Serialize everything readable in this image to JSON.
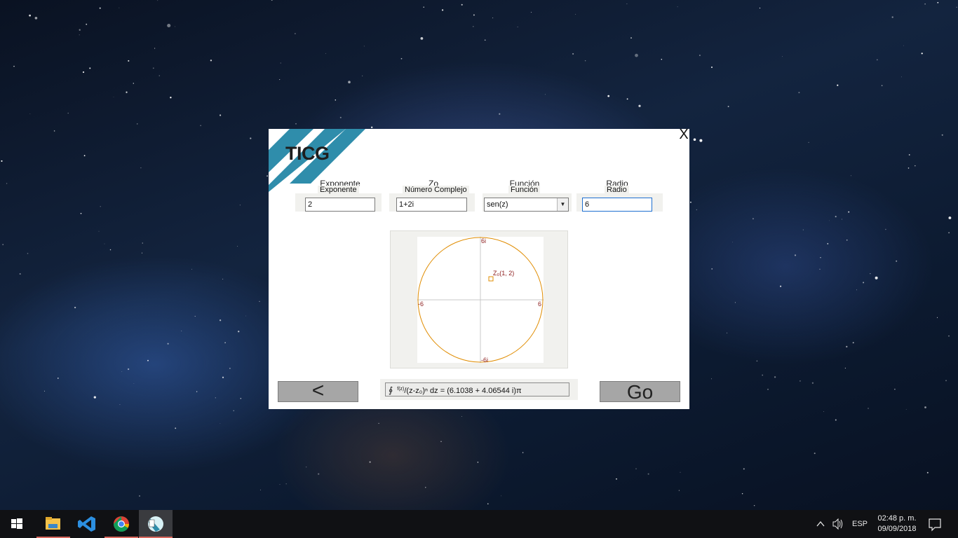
{
  "window": {
    "logo": "TICG",
    "close_label": "X",
    "colors": {
      "stripe": "#2f8dab",
      "background": "#ffffff",
      "panel": "#f1f1ee",
      "circle": "#e08c00",
      "axis_text": "#8b1a1a"
    }
  },
  "fields": {
    "exponente": {
      "title": "Exponente",
      "label": "Exponente",
      "value": "2"
    },
    "zo": {
      "title": "Zo",
      "label": "Número Complejo",
      "value": "1+2i"
    },
    "funcion": {
      "title": "Función",
      "label": "Función",
      "value": "sen(z)"
    },
    "radio": {
      "title": "Radio",
      "label": "Radio",
      "value": "6"
    }
  },
  "graph": {
    "top_label": "6i",
    "bottom_label": "-6i",
    "left_label": "-6",
    "right_label": "6",
    "point_label": "Z₀(1, 2)",
    "radius": 6,
    "center": {
      "re": 1,
      "im": 2
    }
  },
  "buttons": {
    "back_label": "<",
    "go_label": "Go"
  },
  "result": {
    "integral_symbol": "∮",
    "fraction_numerator": "f(z)",
    "fraction_rest": "/(z-z₀)ⁿ dz = (6.1038 + 4.06544 i)π"
  },
  "taskbar": {
    "apps": [
      "windows-start-icon",
      "file-explorer-icon",
      "vscode-icon",
      "chrome-icon",
      "ticg-app-icon"
    ],
    "language": "ESP",
    "time": "02:48 p. m.",
    "date": "09/09/2018"
  }
}
